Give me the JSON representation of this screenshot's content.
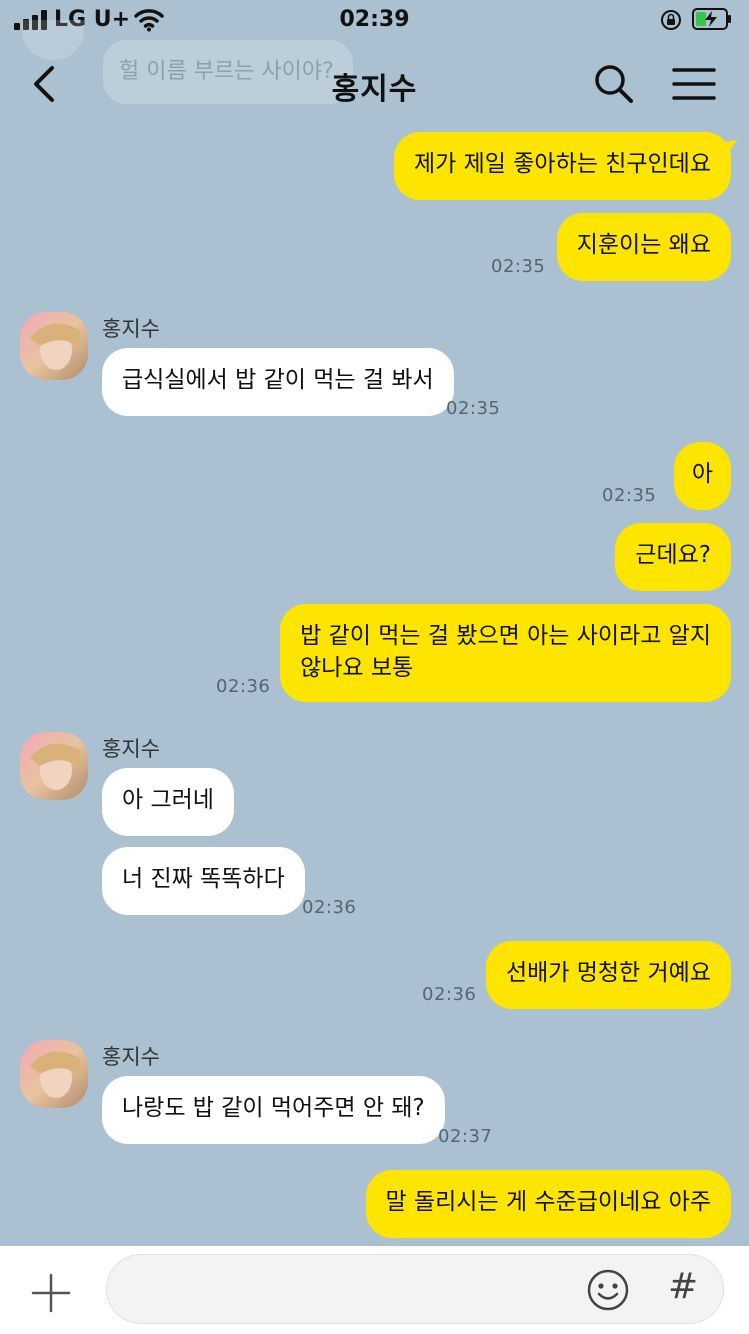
{
  "status": {
    "carrier": "LG U+",
    "time": "02:39"
  },
  "header": {
    "title": "홍지수"
  },
  "faded_preview": "헐 이름 부르는 사이야?",
  "messages": [
    {
      "from": "me",
      "text": "제가 제일 좋아하는 친구인데요",
      "time": ""
    },
    {
      "from": "me",
      "text": "지훈이는 왜요",
      "time": "02:35"
    },
    {
      "from": "them",
      "sender": "홍지수",
      "text": "급식실에서 밥 같이 먹는 걸 봐서",
      "time": "02:35"
    },
    {
      "from": "me",
      "text": "아",
      "time": "02:35"
    },
    {
      "from": "me",
      "text": "근데요?",
      "time": ""
    },
    {
      "from": "me",
      "text": "밥 같이 먹는 걸 봤으면 아는 사이라고 알지",
      "text2": "않나요 보통",
      "time": "02:36"
    },
    {
      "from": "them",
      "sender": "홍지수",
      "text": "아 그러네",
      "time": ""
    },
    {
      "from": "them",
      "text": "너 진짜 똑똑하다",
      "time": "02:36"
    },
    {
      "from": "me",
      "text": "선배가 멍청한 거예요",
      "time": "02:36"
    },
    {
      "from": "them",
      "sender": "홍지수",
      "text": "나랑도 밥 같이 먹어주면 안 돼?",
      "time": "02:37"
    },
    {
      "from": "me",
      "text": "말 돌리시는 게 수준급이네요 아주",
      "time": ""
    }
  ],
  "input": {
    "placeholder": ""
  },
  "colors": {
    "background": "#abc1d1",
    "my_bubble": "#fee500",
    "their_bubble": "#ffffff"
  }
}
